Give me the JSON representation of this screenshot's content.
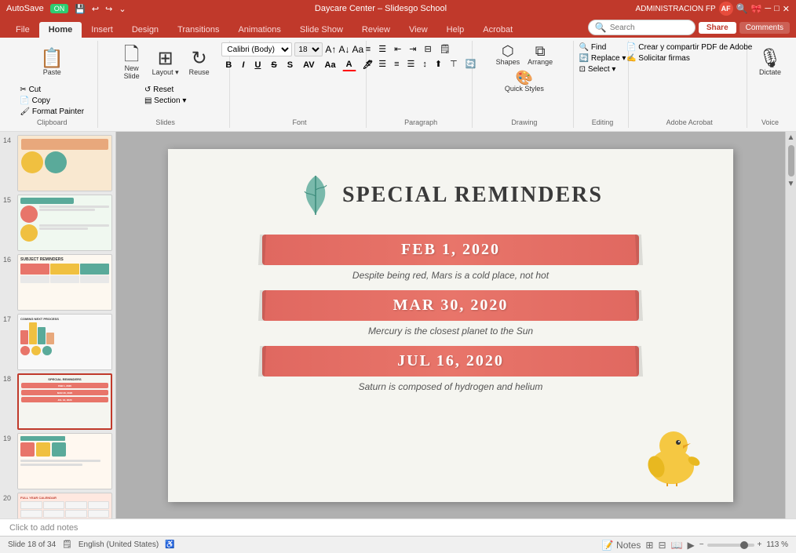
{
  "titleBar": {
    "autosave_label": "AutoSave",
    "autosave_state": "ON",
    "title": "Daycare Center – Slidesgo School",
    "user": "ADMINISTRACION FP",
    "user_initials": "AF"
  },
  "ribbonTabs": [
    {
      "label": "File",
      "active": false
    },
    {
      "label": "Home",
      "active": true
    },
    {
      "label": "Insert",
      "active": false
    },
    {
      "label": "Design",
      "active": false
    },
    {
      "label": "Transitions",
      "active": false
    },
    {
      "label": "Animations",
      "active": false
    },
    {
      "label": "Slide Show",
      "active": false
    },
    {
      "label": "Review",
      "active": false
    },
    {
      "label": "View",
      "active": false
    },
    {
      "label": "Help",
      "active": false
    },
    {
      "label": "Acrobat",
      "active": false
    }
  ],
  "ribbon": {
    "groups": [
      {
        "label": "Clipboard",
        "buttons": [
          "Paste",
          "Cut",
          "Copy",
          "Format Painter"
        ]
      },
      {
        "label": "Slides",
        "buttons": [
          "New Slide",
          "Layout",
          "Reset",
          "Reuse",
          "Section"
        ]
      },
      {
        "label": "Font"
      },
      {
        "label": "Paragraph"
      },
      {
        "label": "Drawing"
      },
      {
        "label": "Editing"
      },
      {
        "label": "Adobe Acrobat"
      },
      {
        "label": "Voice"
      }
    ],
    "share_label": "Share",
    "comments_label": "Comments",
    "search_placeholder": "Search"
  },
  "slidesPanel": {
    "slides": [
      {
        "number": "14",
        "active": false
      },
      {
        "number": "15",
        "active": false
      },
      {
        "number": "16",
        "active": false
      },
      {
        "number": "17",
        "active": false
      },
      {
        "number": "18",
        "active": true
      },
      {
        "number": "19",
        "active": false
      },
      {
        "number": "20",
        "active": false
      }
    ]
  },
  "mainSlide": {
    "title": "SPECIAL REMINDERS",
    "reminders": [
      {
        "date": "FEB 1, 2020",
        "description": "Despite being red, Mars is a cold place, not hot"
      },
      {
        "date": "MAR 30, 2020",
        "description": "Mercury is the closest planet to the Sun"
      },
      {
        "date": "JUL 16, 2020",
        "description": "Saturn is composed of hydrogen and helium"
      }
    ]
  },
  "statusBar": {
    "slide_info": "Slide 18 of 34",
    "language": "English (United States)",
    "notes_label": "Click to add notes",
    "zoom_level": "113 %"
  },
  "colors": {
    "accent_red": "#c0392b",
    "coral": "#e8756a",
    "teal": "#5aaa9a",
    "dark_text": "#3a3a3a"
  }
}
